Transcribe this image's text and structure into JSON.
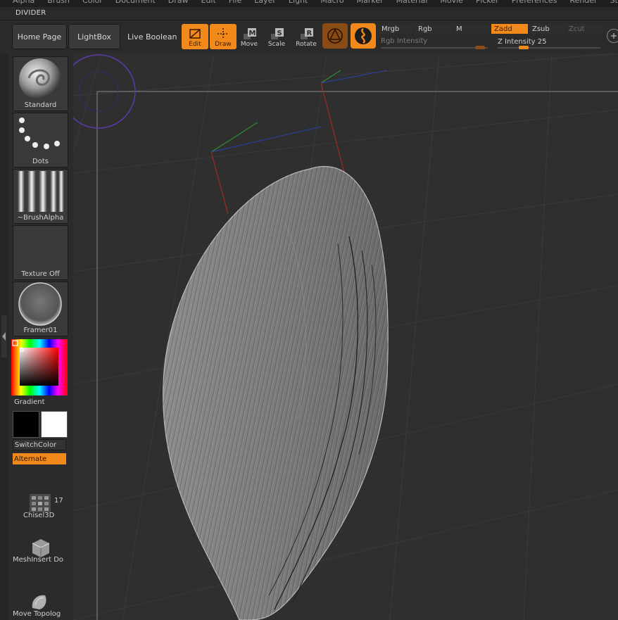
{
  "menu": {
    "items": [
      "Alpha",
      "Brush",
      "Color",
      "Document",
      "Draw",
      "Edit",
      "File",
      "Layer",
      "Light",
      "Macro",
      "Marker",
      "Material",
      "Movie",
      "Picker",
      "Preferences",
      "Render",
      "Stencil",
      "St"
    ]
  },
  "palette_title": "DIVIDER",
  "toolbar": {
    "home_page": "Home Page",
    "lightbox": "LightBox",
    "live_boolean": "Live Boolean",
    "edit": "Edit",
    "draw": "Draw",
    "move": "Move",
    "scale": "Scale",
    "rotate": "Rotate",
    "mrgb": "Mrgb",
    "rgb": "Rgb",
    "m": "M",
    "zadd": "Zadd",
    "zsub": "Zsub",
    "zcut": "Zcut",
    "rgb_intensity": "Rgb Intensity",
    "z_intensity": "Z Intensity 25",
    "z_intensity_value": 25,
    "z_intensity_fraction": 0.25,
    "rgb_intensity_fraction": 0.93
  },
  "shelf": {
    "standard": "Standard",
    "dots": "Dots",
    "brush_alpha": "~BrushAlpha",
    "texture_off": "Texture Off",
    "framer": "Framer01",
    "gradient": "Gradient",
    "switch_color": "SwitchColor",
    "alternate": "Alternate",
    "chisel": "Chisel3D",
    "chisel_count": "17",
    "mesh_insert": "MeshInsert Do",
    "move_topolog": "Move Topolog"
  },
  "colors": {
    "accent": "#f28a1b",
    "primary_color": "#000000",
    "secondary_color": "#ffffff"
  }
}
